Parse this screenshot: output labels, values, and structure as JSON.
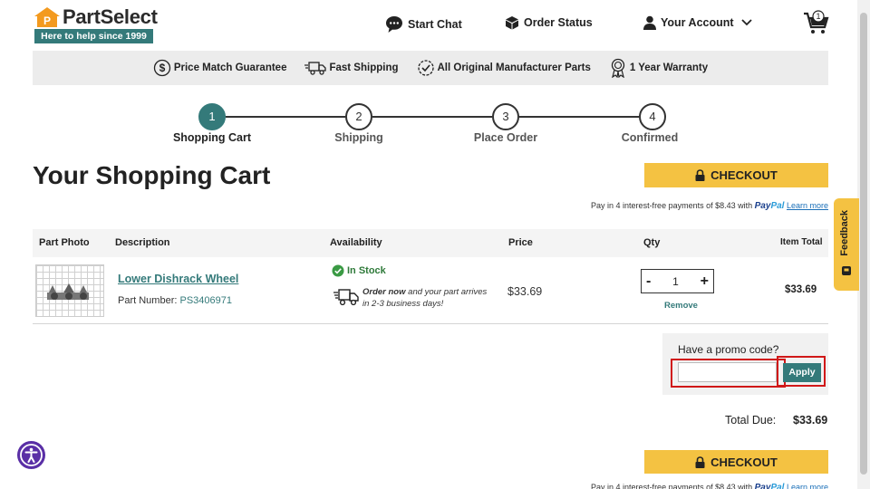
{
  "header": {
    "brand": "PartSelect",
    "tagline": "Here to help since 1999",
    "start_chat": "Start Chat",
    "order_status": "Order Status",
    "your_account": "Your Account",
    "cart_count": "1"
  },
  "benefits": [
    {
      "label": "Price Match Guarantee",
      "icon": "dollar-circle-icon"
    },
    {
      "label": "Fast Shipping",
      "icon": "truck-icon"
    },
    {
      "label": "All Original Manufacturer Parts",
      "icon": "badge-check-icon"
    },
    {
      "label": "1 Year Warranty",
      "icon": "ribbon-icon"
    }
  ],
  "steps": [
    {
      "number": "1",
      "label": "Shopping Cart",
      "active": true
    },
    {
      "number": "2",
      "label": "Shipping",
      "active": false
    },
    {
      "number": "3",
      "label": "Place Order",
      "active": false
    },
    {
      "number": "4",
      "label": "Confirmed",
      "active": false
    }
  ],
  "page_title": "Your Shopping Cart",
  "checkout_label": "CHECKOUT",
  "paypal": {
    "text": "Pay in 4 interest-free payments of $8.43 with",
    "brand_pay": "Pay",
    "brand_pal": "Pal",
    "learn_more": "Learn more"
  },
  "table": {
    "headers": {
      "photo": "Part Photo",
      "description": "Description",
      "availability": "Availability",
      "price": "Price",
      "qty": "Qty",
      "item_total": "Item Total"
    },
    "item": {
      "name": "Lower Dishrack Wheel",
      "part_number_label": "Part Number:",
      "part_number": "PS3406971",
      "stock": "In Stock",
      "ship_bold": "Order now",
      "ship_rest": "and your part arrives",
      "ship_line2": "in 2-3 business days!",
      "price": "$33.69",
      "qty": "1",
      "qty_minus": "-",
      "qty_plus": "+",
      "remove": "Remove",
      "total": "$33.69"
    }
  },
  "promo": {
    "label": "Have a promo code?",
    "placeholder": "",
    "apply": "Apply"
  },
  "totals": {
    "label": "Total Due:",
    "value": "$33.69"
  },
  "feedback_label": "Feedback",
  "colors": {
    "teal": "#347a7a",
    "yellow": "#f4c242",
    "highlight_red": "#d01818",
    "access_purple": "#5a2fa6"
  }
}
